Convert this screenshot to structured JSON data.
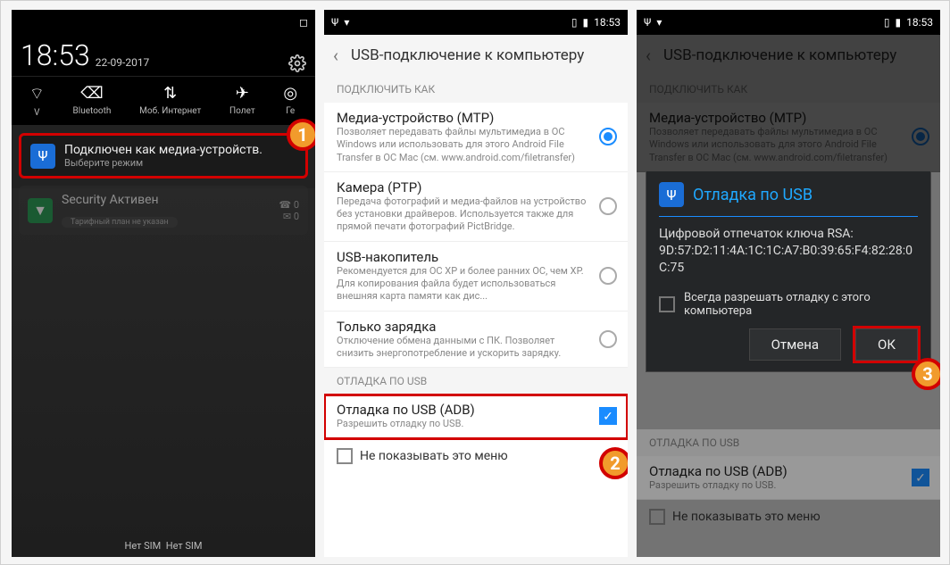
{
  "status": {
    "time": "18:53",
    "date": "22-09-2017"
  },
  "quicksettings": {
    "wifi": "V",
    "bt": "Bluetooth",
    "data": "Моб. Интернет",
    "plane": "Полет",
    "gps": "Ге"
  },
  "notif_usb": {
    "title": "Подключен как медиа-устройств.",
    "sub": "Выберите режим"
  },
  "notif_sec": {
    "title": "Security Активен",
    "plan": "Тарифный план не указан",
    "count": "0"
  },
  "dock": {
    "left": "Нет SIM",
    "right": "Нет SIM"
  },
  "appbar_title": "USB-подключение к компьютеру",
  "section_connect": "ПОДКЛЮЧИТЬ КАК",
  "section_debug": "ОТЛАДКА ПО USB",
  "opt_mtp": {
    "title": "Медиа-устройство (МТР)",
    "desc": "Позволяет передавать файлы мультимедиа в ОС Windows или использовать для этого Android File Transfer в ОС Mac (см. www.android.com/filetransfer)"
  },
  "opt_ptp": {
    "title": "Камера (PTP)",
    "desc": "Передача фотографий и медиа-файлов на устройство без установки драйверов. Используется также для прямой печати фотографий PictBridge."
  },
  "opt_mass": {
    "title": "USB-накопитель",
    "desc": "Рекомендуется для ОС XP и более ранних ОС, чем XP. Для копирования файла будет использоваться внешняя карта памяти как дис..."
  },
  "opt_charge": {
    "title": "Только зарядка",
    "desc": "Отключение обмена данными с ПК. Позволяет снизить энергопотребление и ускорить зарядку."
  },
  "opt_adb": {
    "title": "Отладка по USB (ADB)",
    "desc": "Разрешить отладку по USB."
  },
  "foot_noshow": "Не показывать это меню",
  "dialog": {
    "title": "Отладка по USB",
    "body1": "Цифровой отпечаток ключа RSA:",
    "body2": "9D:57:D2:11:4A:1C:1C:A7:B0:39:65:F4:82:28:0C:75",
    "always": "Всегда разрешать отладку с этого компьютера",
    "cancel": "Отмена",
    "ok": "ОК"
  },
  "badges": {
    "b1": "1",
    "b2": "2",
    "b3": "3"
  }
}
